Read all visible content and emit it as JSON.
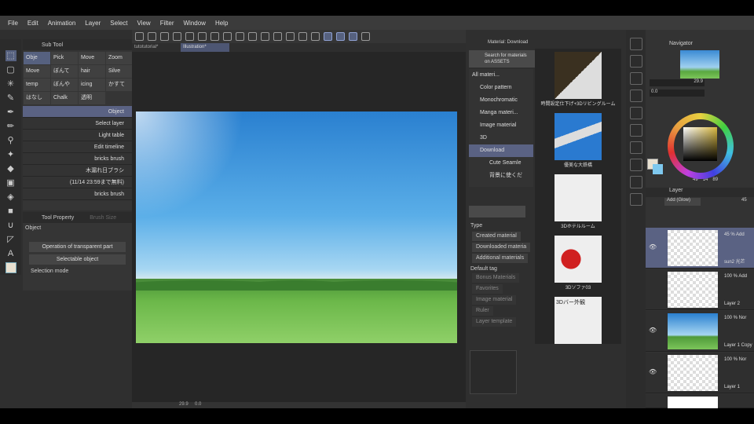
{
  "menu": [
    "File",
    "Edit",
    "Animation",
    "Layer",
    "Select",
    "View",
    "Filter",
    "Window",
    "Help"
  ],
  "tabs": [
    "tutotutorial*",
    "Illustration*"
  ],
  "subtool": {
    "title": "Sub Tool",
    "grid": [
      "Obje",
      "Pick",
      "Move",
      "Zoom",
      "Move",
      "ぼんて",
      "hair",
      "Silve",
      "temp",
      "ぼんや",
      "icing",
      "かすて",
      "はなし",
      "Chalk",
      "透明"
    ],
    "list": [
      "Object",
      "Select layer",
      "Light table",
      "Edit timeline",
      "bricks brush",
      "木漏れ日ブラシ",
      "(11/14 23:59まで無料)",
      "bricks brush"
    ]
  },
  "toolprop": {
    "tab1": "Tool Property",
    "tab2": "Brush Size",
    "section": "Object",
    "transparent": "Operation of transparent part",
    "selectable": "Selectable object",
    "selection_mode": "Selection mode"
  },
  "status": {
    "zoom": "29.9",
    "angle": "0.0"
  },
  "material": {
    "title": "Material: Download",
    "search": "Search for materials on ASSETS",
    "tree": [
      "All materi...",
      "Color pattern",
      "Monochromatic",
      "Manga materi...",
      "Image material",
      "3D",
      "Download",
      "Cute Seamle",
      "背景に使くだ"
    ],
    "type_label": "Type",
    "types": [
      "Created material",
      "Downloaded materia",
      "Additional materials"
    ],
    "tag_label": "Default tag",
    "tags": [
      "Bonus Materials",
      "Favorites",
      "Image material",
      "Ruler",
      "Layer template"
    ],
    "items": [
      "時間設定仕下げ+3Dリビングルーム",
      "優美な大鉄橋",
      "3Dホテルルーム",
      "3Dソファ03",
      "3Dバー外観"
    ]
  },
  "navigator": {
    "title": "Navigator",
    "zoom": "29.9",
    "angle": "0.0"
  },
  "color": {
    "h": "49",
    "s": "14",
    "v": "89"
  },
  "layer": {
    "title": "Layer",
    "blend": "Add (Glow)",
    "opacity": "45",
    "layers": [
      {
        "mode": "45 % Add",
        "name": "sun2 光芒"
      },
      {
        "mode": "100 % Add",
        "name": "Layer 2"
      },
      {
        "mode": "100 % Nor",
        "name": "Layer 1 Copy"
      },
      {
        "mode": "100 % Nor",
        "name": "Layer 1"
      }
    ]
  }
}
